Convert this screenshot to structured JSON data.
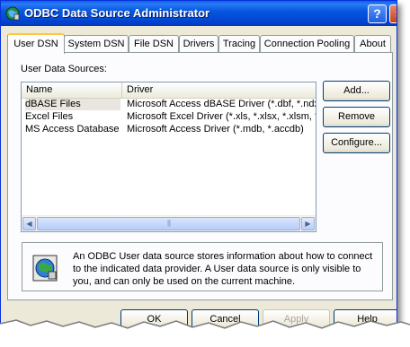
{
  "window": {
    "title": "ODBC Data Source Administrator",
    "help_glyph": "?",
    "close_glyph": "×"
  },
  "tabs": [
    {
      "label": "User DSN",
      "active": true
    },
    {
      "label": "System DSN"
    },
    {
      "label": "File DSN"
    },
    {
      "label": "Drivers"
    },
    {
      "label": "Tracing"
    },
    {
      "label": "Connection Pooling"
    },
    {
      "label": "About"
    }
  ],
  "user_dsn": {
    "section_label": "User Data Sources:",
    "columns": [
      "Name",
      "Driver"
    ],
    "rows": [
      {
        "name": "dBASE Files",
        "driver": "Microsoft Access dBASE Driver (*.dbf, *.ndx"
      },
      {
        "name": "Excel Files",
        "driver": "Microsoft Excel Driver (*.xls, *.xlsx, *.xlsm, *.x"
      },
      {
        "name": "MS Access Database",
        "driver": "Microsoft Access Driver (*.mdb, *.accdb)"
      }
    ],
    "buttons": {
      "add": "Add...",
      "remove": "Remove",
      "configure": "Configure..."
    },
    "info_text": "An ODBC User data source stores information about how to connect to the indicated data provider.   A User data source is only visible to you, and can only be used on the current machine."
  },
  "footer": {
    "ok": "OK",
    "cancel": "Cancel",
    "apply": "Apply",
    "help": "Help"
  },
  "colors": {
    "titlebar": "#0054e3",
    "tab_highlight": "#ffc83c",
    "face": "#ece9d8"
  }
}
